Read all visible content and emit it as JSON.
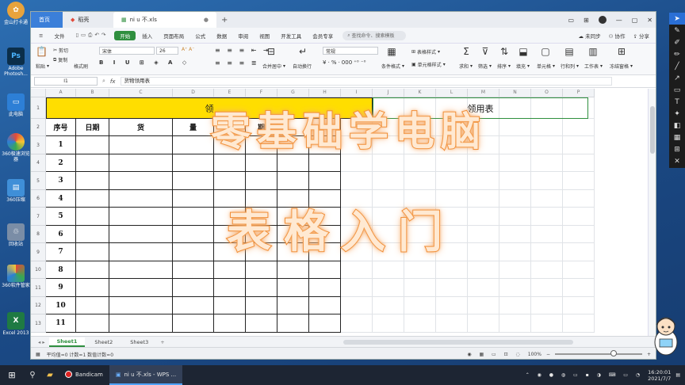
{
  "desktop": {
    "icons": [
      {
        "label": "金山打卡通",
        "glyph": "",
        "color": "#e8a33c"
      },
      {
        "label": "Adobe Photosh...",
        "glyph": "Ps",
        "color": "#0b2e4a"
      },
      {
        "label": "此电脑",
        "glyph": "▭",
        "color": "#2d7fd6"
      },
      {
        "label": "360极速浏览器",
        "glyph": "",
        "color": "#38a852"
      },
      {
        "label": "360压缩",
        "glyph": "",
        "color": "#3f8fd8"
      },
      {
        "label": "回收站",
        "glyph": "♲",
        "color": "#7a8da6"
      },
      {
        "label": "360软件管家",
        "glyph": "",
        "color": "#e24a3a"
      },
      {
        "label": "Excel 2013",
        "glyph": "X",
        "color": "#1f7a43"
      }
    ]
  },
  "window": {
    "tabs": [
      {
        "label": "首页"
      },
      {
        "label": "稻壳"
      },
      {
        "label": "ni u 不.xls"
      }
    ],
    "menu": [
      "文件",
      "开始",
      "插入",
      "页面布局",
      "公式",
      "数据",
      "审阅",
      "视图",
      "开发工具",
      "会员专享"
    ],
    "active_menu": "开始",
    "search_placeholder": "查找命令、搜索模板",
    "menu_right": [
      "未同步",
      "协作",
      "分享"
    ],
    "ribbon": {
      "cut": "剪切",
      "copy": "复制",
      "format_painter": "格式刷",
      "paste": "粘贴",
      "font_name": "宋体",
      "font_size": "26",
      "merge": "合并居中",
      "wrap": "自动换行",
      "number_format": "常规",
      "percent": "%",
      "thousands": "000",
      "cond_format": "条件格式",
      "table_style": "表格样式",
      "cell_style": "单元格样式",
      "sum": "求和",
      "filter": "筛选",
      "sort": "排序",
      "fill": "填充",
      "cell": "单元格",
      "rowcol": "行和列",
      "worksheet": "工作表",
      "freeze": "冻结窗格"
    },
    "namebox": "I1",
    "formula": "货物领用表"
  },
  "grid": {
    "columns": [
      "A",
      "B",
      "C",
      "D",
      "E",
      "F",
      "G",
      "H",
      "I",
      "J",
      "K",
      "L",
      "M",
      "N",
      "O",
      "P"
    ],
    "rows": [
      "1",
      "2",
      "3",
      "4",
      "5",
      "6",
      "7",
      "8",
      "9",
      "10",
      "11",
      "12",
      "13"
    ],
    "title_left": "领",
    "title_right": "领用表",
    "headers": [
      "序号",
      "日期",
      "货",
      "量",
      "",
      "期"
    ],
    "seq": [
      "1",
      "2",
      "3",
      "4",
      "5",
      "6",
      "7",
      "8",
      "9",
      "10",
      "11"
    ]
  },
  "sheets": [
    "Sheet1",
    "Sheet2",
    "Sheet3"
  ],
  "active_sheet": "Sheet1",
  "status": {
    "summary": "平均值=0  计数=1  数值计数=0",
    "zoom": "100%"
  },
  "overlay": {
    "line1": "零基础学电脑",
    "line2": "表格入门"
  },
  "taskbar": {
    "apps": [
      "Bandicam",
      "ni u 不.xls - WPS ..."
    ],
    "time": "16:20:01",
    "date": "2021/7/7"
  }
}
